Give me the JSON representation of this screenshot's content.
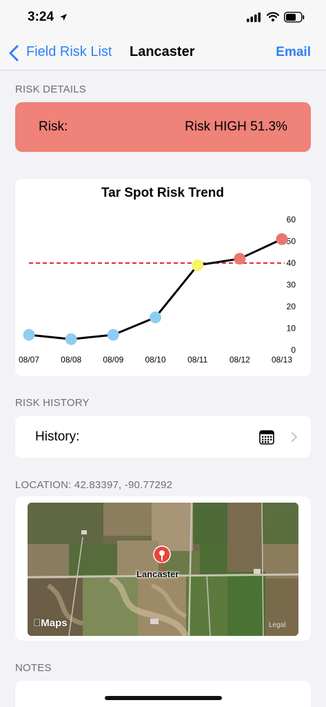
{
  "status_bar": {
    "time": "3:24"
  },
  "nav": {
    "back_label": "Field Risk List",
    "title": "Lancaster",
    "action_label": "Email"
  },
  "sections": {
    "risk_details": "RISK DETAILS",
    "risk_history": "RISK HISTORY",
    "location": "LOCATION: 42.83397, -90.77292",
    "notes": "NOTES"
  },
  "risk": {
    "label": "Risk:",
    "value": "Risk HIGH 51.3%",
    "color": "#ef8279"
  },
  "history": {
    "label": "History:"
  },
  "map": {
    "pin_label": "Lancaster",
    "brand": "Maps",
    "legal": "Legal"
  },
  "colors": {
    "accent": "#2f7ff6",
    "low": "#8ecdf2",
    "medium": "#f6f46b",
    "high": "#ea7572",
    "threshold": "#d9302b"
  },
  "chart_data": {
    "type": "line",
    "title": "Tar Spot Risk Trend",
    "categories": [
      "08/07",
      "08/08",
      "08/09",
      "08/10",
      "08/11",
      "08/12",
      "08/13"
    ],
    "values": [
      7,
      5,
      7,
      15,
      39,
      42,
      51
    ],
    "point_levels": [
      "low",
      "low",
      "low",
      "low",
      "medium",
      "high",
      "high"
    ],
    "threshold": 40,
    "ylim": [
      0,
      60
    ],
    "yticks": [
      0,
      10,
      20,
      30,
      40,
      50,
      60
    ],
    "y_axis_side": "right",
    "grid": false
  }
}
